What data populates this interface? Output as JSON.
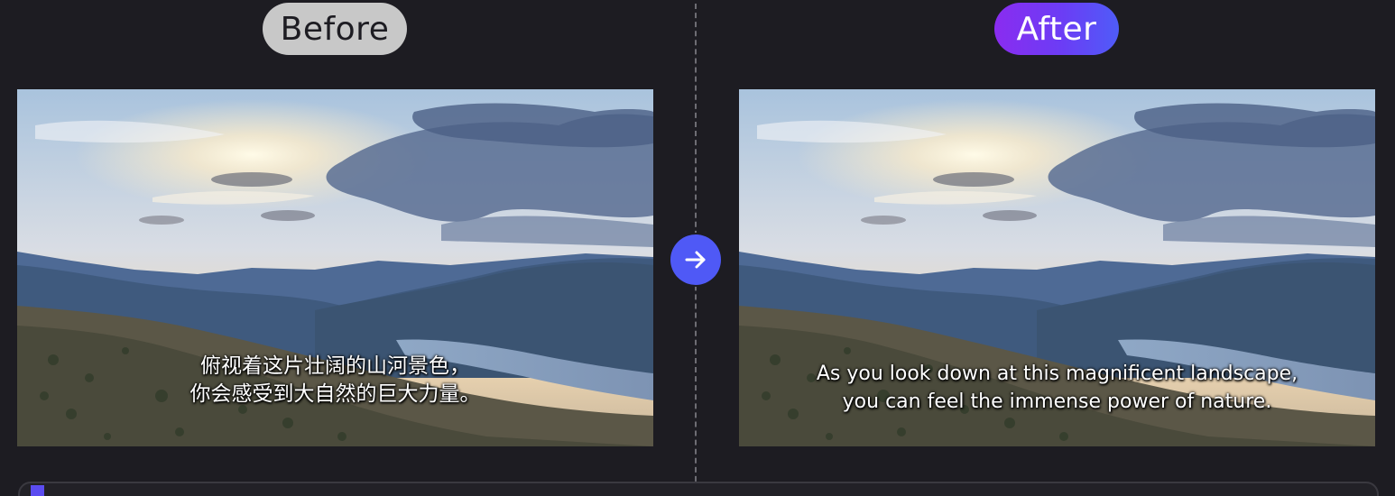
{
  "labels": {
    "before": "Before",
    "after": "After"
  },
  "before_panel": {
    "subtitle_lines": [
      "俯视着这片壮阔的山河景色，",
      "你会感受到大自然的巨大力量。"
    ]
  },
  "after_panel": {
    "subtitle_lines": [
      "As you look down at this magnificent landscape,",
      "you can feel the immense power of nature."
    ]
  },
  "icons": {
    "transition": "arrow-right-icon"
  },
  "colors": {
    "background": "#1d1c22",
    "before_pill": "#c8c8c8",
    "after_pill_gradient": [
      "#8a2cf0",
      "#4f5cf8"
    ],
    "arrow_button": "#4f59f6",
    "playhead": "#5b4cf0"
  }
}
